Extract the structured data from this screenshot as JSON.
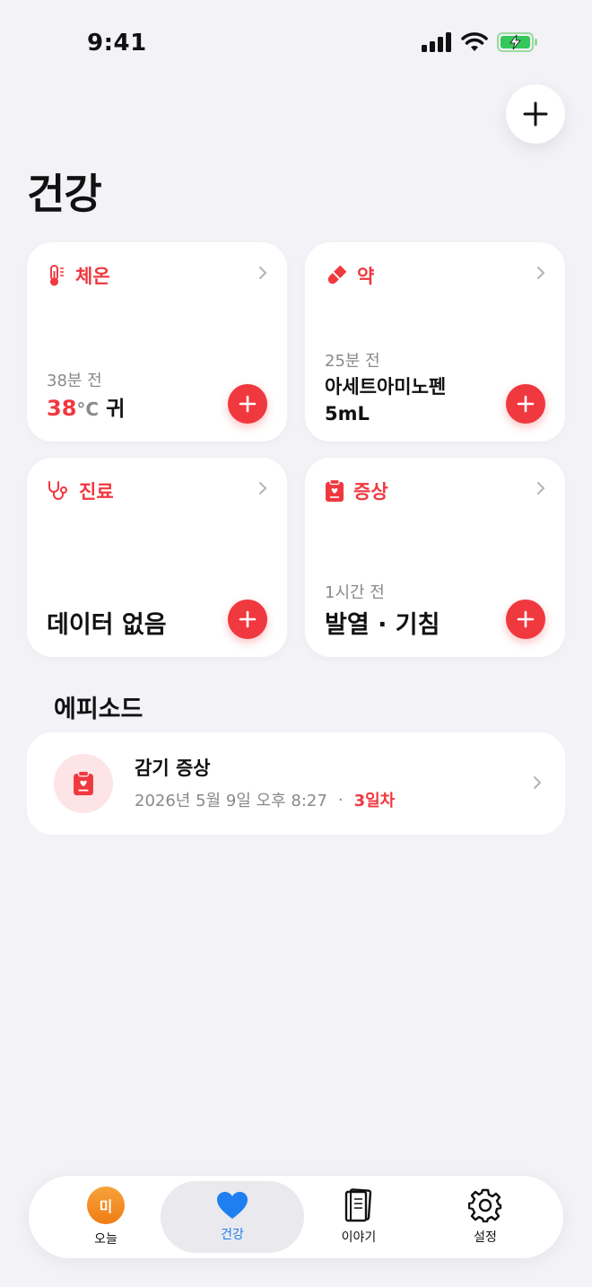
{
  "status": {
    "time": "9:41"
  },
  "page_title": "건강",
  "cards": [
    {
      "title": "체온",
      "time": "38분 전",
      "temp_value": "38",
      "temp_unit": "°C",
      "temp_site": "귀"
    },
    {
      "title": "약",
      "time": "25분 전",
      "value_line1": "아세트아미노펜",
      "value_line2": "5mL"
    },
    {
      "title": "진료",
      "value": "데이터 없음"
    },
    {
      "title": "증상",
      "time": "1시간 전",
      "value": "발열 · 기침"
    }
  ],
  "episodes": {
    "section_title": "에피소드",
    "items": [
      {
        "title": "감기 증상",
        "date": "2026년 5월 9일 오후 8:27",
        "separator": "·",
        "day": "3일차"
      }
    ]
  },
  "tabbar": {
    "avatar_initial": "미",
    "tabs": [
      {
        "label": "오늘"
      },
      {
        "label": "건강"
      },
      {
        "label": "이야기"
      },
      {
        "label": "설정"
      }
    ]
  },
  "colors": {
    "accent_red": "#f0383f",
    "active_blue": "#1f7ff0",
    "background": "#f2f2f7"
  }
}
